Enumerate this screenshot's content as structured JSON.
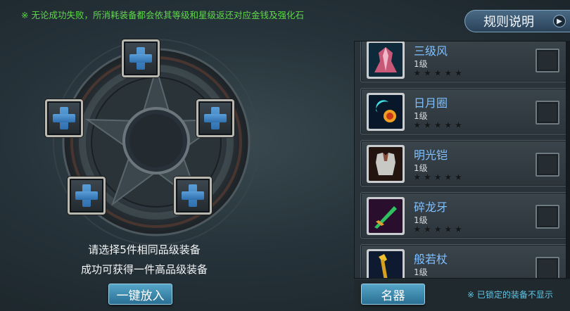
{
  "notice": "※ 无论成功失败，所消耗装备都会依其等级和星级返还对应金钱及强化石",
  "rules_button": {
    "label": "规则说明",
    "icon": "play-arrow-icon"
  },
  "slots": [
    {
      "name": "slot-top",
      "icon": "plus-icon"
    },
    {
      "name": "slot-left",
      "icon": "plus-icon"
    },
    {
      "name": "slot-right",
      "icon": "plus-icon"
    },
    {
      "name": "slot-bottom-left",
      "icon": "plus-icon"
    },
    {
      "name": "slot-bottom-right",
      "icon": "plus-icon"
    }
  ],
  "hint": {
    "line1": "请选择5件相同品级装备",
    "line2": "成功可获得一件高品级装备"
  },
  "one_click_label": "一键放入",
  "equipment": [
    {
      "name": "三级风",
      "level": "1级",
      "stars_filled": 0,
      "stars_total": 5,
      "icon": "robe-icon",
      "checked": false
    },
    {
      "name": "日月圈",
      "level": "1级",
      "stars_filled": 0,
      "stars_total": 5,
      "icon": "sun-moon-ring-icon",
      "checked": false
    },
    {
      "name": "明光铠",
      "level": "1级",
      "stars_filled": 0,
      "stars_total": 5,
      "icon": "armor-icon",
      "checked": false
    },
    {
      "name": "碎龙牙",
      "level": "1级",
      "stars_filled": 0,
      "stars_total": 5,
      "icon": "dragon-blade-icon",
      "checked": false
    },
    {
      "name": "般若杖",
      "level": "1级",
      "stars_filled": 0,
      "stars_total": 5,
      "icon": "staff-icon",
      "checked": false
    }
  ],
  "category_tab": "名器",
  "locked_note": "※ 已锁定的装备不显示",
  "colors": {
    "notice": "#5fd84a",
    "item_name": "#7fc0ff",
    "locked_note": "#5fc8e8",
    "accent_button": "#3a8cb0"
  }
}
